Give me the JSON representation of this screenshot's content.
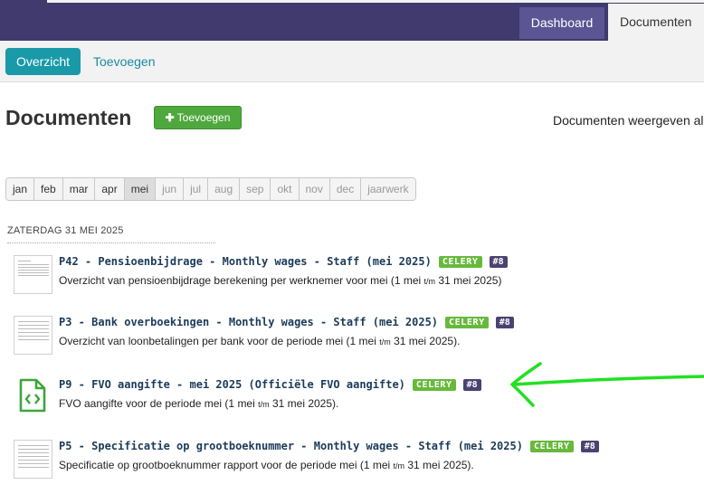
{
  "nav": {
    "tabs": [
      {
        "label": "Dashboard"
      },
      {
        "label": "Documenten"
      }
    ]
  },
  "subnav": {
    "active": "Overzicht",
    "link": "Toevoegen"
  },
  "page": {
    "title": "Documenten",
    "add_button": "Toevoegen",
    "right_label": "Documenten weergeven al"
  },
  "months": [
    "jan",
    "feb",
    "mar",
    "apr",
    "mei",
    "jun",
    "jul",
    "aug",
    "sep",
    "okt",
    "nov",
    "dec",
    "jaarwerk"
  ],
  "selected_month": "mei",
  "date_heading": "ZATERDAG 31 MEI 2025",
  "documents": [
    {
      "title": "P42 - Pensioenbijdrage - Monthly wages - Staff (mei 2025)",
      "badge": "CELERY",
      "number": "#8",
      "desc_prefix": "Overzicht van pensioenbijdrage berekening per werknemer voor mei (1 mei",
      "desc_tm": "t/m",
      "desc_suffix": "31 mei 2025)",
      "icon": "document-thumbnail-icon"
    },
    {
      "title": "P3 - Bank overboekingen - Monthly wages - Staff (mei 2025)",
      "badge": "CELERY",
      "number": "#8",
      "desc_prefix": "Overzicht van loonbetalingen per bank voor de periode mei (1 mei",
      "desc_tm": "t/m",
      "desc_suffix": "31 mei 2025).",
      "icon": "document-thumbnail-icon"
    },
    {
      "title": "P9 - FVO aangifte - mei 2025 (Officiële FVO aangifte)",
      "badge": "CELERY",
      "number": "#8",
      "desc_prefix": "FVO aangifte voor de periode mei (1 mei",
      "desc_tm": "t/m",
      "desc_suffix": "31 mei 2025).",
      "icon": "code-file-icon"
    },
    {
      "title": "P5 - Specificatie op grootboeknummer - Monthly wages - Staff (mei 2025)",
      "badge": "CELERY",
      "number": "#8",
      "desc_prefix": "Specificatie op grootboeknummer rapport voor de periode mei (1 mei",
      "desc_tm": "t/m",
      "desc_suffix": "31 mei 2025).",
      "icon": "document-thumbnail-icon"
    }
  ],
  "colors": {
    "topbar": "#413a6e",
    "accent": "#1a99a9",
    "add_button": "#4fa83d",
    "celery_badge": "#67b93c",
    "number_badge": "#4a4270",
    "arrow": "#22e022"
  }
}
